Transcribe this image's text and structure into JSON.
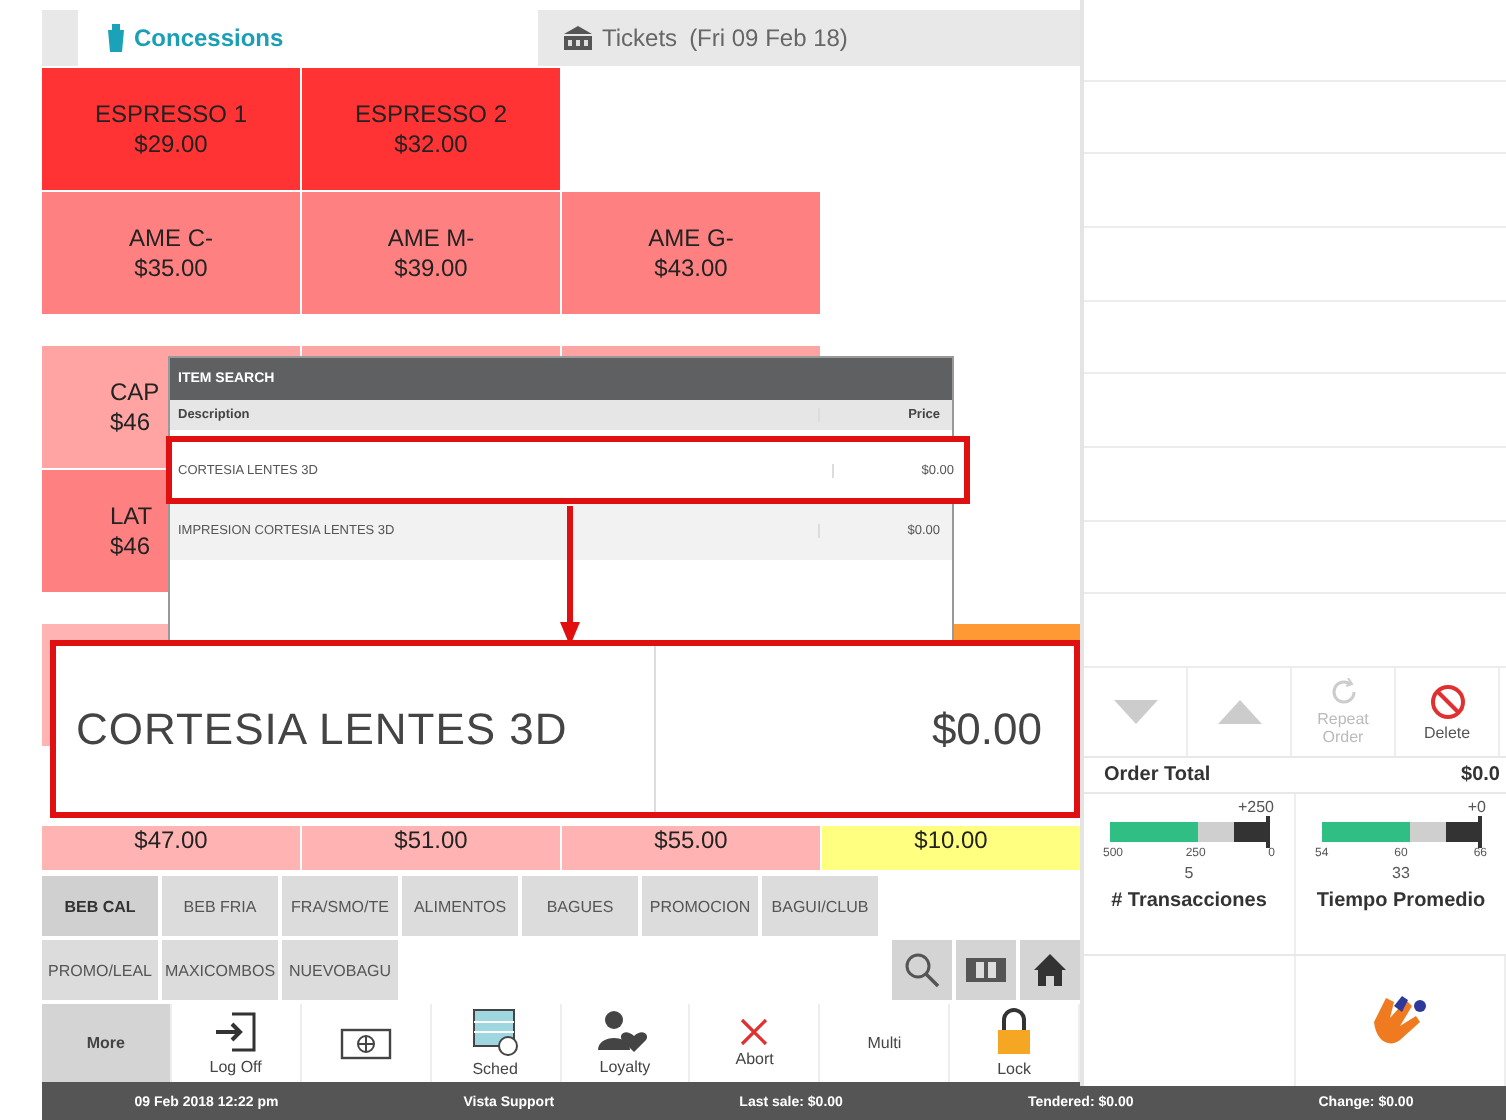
{
  "tabs": [
    {
      "kind": "concessions",
      "label": "Concessions",
      "selected": true
    },
    {
      "kind": "tickets",
      "label": "Tickets",
      "detail": "(Fri 09 Feb 18)",
      "selected": false
    }
  ],
  "tile_groups": [
    [
      [
        {
          "kind": "full",
          "label": "ESPRESSO 1",
          "price": "$29.00",
          "color": "#ff3333"
        },
        {
          "kind": "full",
          "label": "ESPRESSO 2",
          "price": "$32.00",
          "color": "#ff3333"
        },
        {
          "kind": "empty"
        },
        {
          "kind": "empty"
        }
      ],
      [
        {
          "kind": "full",
          "label": "AME  C-",
          "price": "$35.00",
          "color": "#ff8080"
        },
        {
          "kind": "full",
          "label": "AME  M-",
          "price": "$39.00",
          "color": "#ff8080"
        },
        {
          "kind": "full",
          "label": "AME  G-",
          "price": "$43.00",
          "color": "#ff8080"
        },
        {
          "kind": "empty"
        }
      ]
    ],
    [
      [
        {
          "kind": "cut",
          "label": "CAP",
          "price": "$46",
          "color": "#ffa3a3"
        },
        {
          "kind": "covered",
          "color": "#ffa3a3"
        },
        {
          "kind": "covered",
          "color": "#ffa3a3"
        },
        {
          "kind": "empty"
        }
      ],
      [
        {
          "kind": "cut",
          "label": "LAT",
          "price": "$46",
          "color": "#ff8080"
        },
        {
          "kind": "hidden"
        },
        {
          "kind": "hidden"
        },
        {
          "kind": "empty"
        }
      ]
    ],
    [
      [
        {
          "kind": "covered",
          "color": "#ffb3b3"
        },
        {
          "kind": "hidden"
        },
        {
          "kind": "hidden"
        },
        {
          "kind": "covered",
          "color": "#ff9933"
        }
      ],
      [
        {
          "kind": "lower",
          "price": "$47.00",
          "color": "#ffb3b3"
        },
        {
          "kind": "lower",
          "price": "$51.00",
          "color": "#ffb3b3"
        },
        {
          "kind": "lower",
          "price": "$55.00",
          "color": "#ffb3b3"
        },
        {
          "kind": "lower",
          "price": "$10.00",
          "color": "#ffff80"
        }
      ]
    ]
  ],
  "item_search": {
    "title": "ITEM SEARCH",
    "columns": [
      "Description",
      "Price"
    ],
    "rows": [
      {
        "description": "CORTESIA LENTES 3D",
        "price": "$0.00",
        "highlighted": true
      },
      {
        "description": "IMPRESION CORTESIA LENTES 3D",
        "price": "$0.00",
        "highlighted": false
      }
    ]
  },
  "callout": {
    "description": "CORTESIA LENTES 3D",
    "price": "$0.00"
  },
  "order_buttons": [
    {
      "kind": "down",
      "disabled": true
    },
    {
      "kind": "up",
      "disabled": true
    },
    {
      "kind": "repeat",
      "label": "Repeat Order",
      "disabled": true
    },
    {
      "kind": "delete",
      "label": "Delete",
      "disabled": false
    }
  ],
  "order_total": {
    "label": "Order Total",
    "amount": "$0.0"
  },
  "gauges": [
    {
      "target": "+250",
      "ticks": [
        "500",
        "250",
        "0"
      ],
      "value": "5",
      "label": "# Transacciones"
    },
    {
      "target": "+0",
      "ticks": [
        "54",
        "60",
        "66"
      ],
      "value": "33",
      "label": "Tiempo Promedio"
    }
  ],
  "category_rows": [
    [
      {
        "label": "BEB CAL",
        "selected": true
      },
      {
        "label": "BEB FRIA",
        "selected": false
      },
      {
        "label": "FRA/SMO/TE",
        "selected": false
      },
      {
        "label": "ALIMENTOS",
        "selected": false
      },
      {
        "label": "BAGUES",
        "selected": false
      },
      {
        "label": "PROMOCION",
        "selected": false
      },
      {
        "label": "BAGUI/CLUB",
        "selected": false
      }
    ],
    [
      {
        "label": "PROMO/LEAL",
        "selected": false
      },
      {
        "label": "MAXICOMBOS",
        "selected": false
      },
      {
        "label": "NUEVOBAGU",
        "selected": false
      }
    ]
  ],
  "toolbar": [
    {
      "kind": "more",
      "label": "More"
    },
    {
      "kind": "logoff",
      "label": "Log Off"
    },
    {
      "kind": "screen"
    },
    {
      "kind": "sched",
      "label": "Sched"
    },
    {
      "kind": "loyalty",
      "label": "Loyalty"
    },
    {
      "kind": "abort",
      "label": "Abort"
    },
    {
      "kind": "multi",
      "label": "Multi"
    },
    {
      "kind": "lock",
      "label": "Lock"
    }
  ],
  "status_bar": [
    "09 Feb 2018 12:22 pm",
    "Vista Support",
    "Last sale: $0.00",
    "Tendered: $0.00",
    "Change: $0.00"
  ]
}
